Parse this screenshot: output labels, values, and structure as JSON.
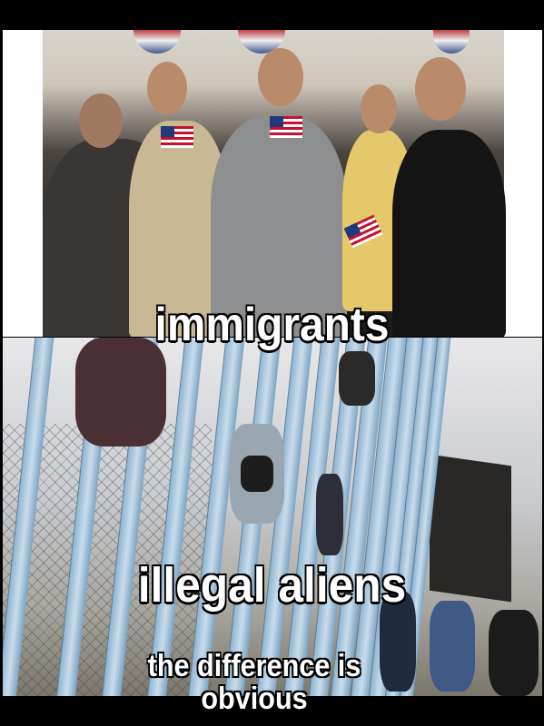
{
  "meme": {
    "top_caption": "immigrants",
    "middle_caption": "illegal aliens",
    "bottom_caption_line1": "the difference is",
    "bottom_caption_line2": "obvious"
  },
  "colors": {
    "background": "#000000",
    "caption_text": "#ffffff",
    "fence_blue": "#a9c6dc"
  }
}
